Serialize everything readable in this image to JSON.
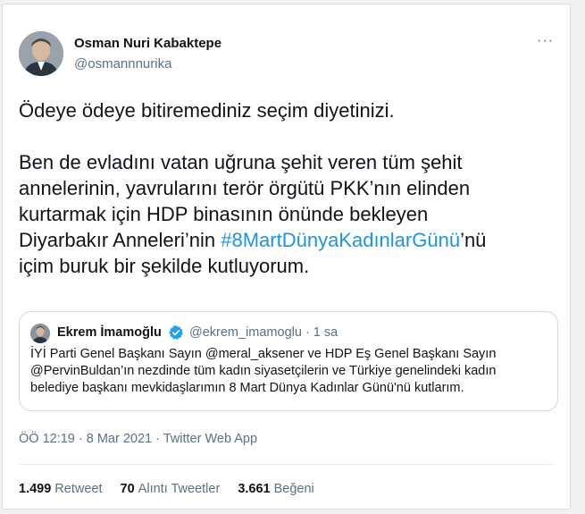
{
  "author": {
    "name": "Osman Nuri Kabaktepe",
    "handle": "@osmannnurika",
    "more": "···"
  },
  "tweet": {
    "line1": "Ödeye ödeye bitiremediniz seçim diyetinizi.",
    "line2": "Ben de evladını vatan uğruna şehit veren tüm şehit",
    "line3": "annelerinin, yavrularını terör örgütü PKK’nın elinden",
    "line4": "kurtarmak için HDP binasının önünde bekleyen",
    "line5_pre": "Diyarbakır Anneleri’nin ",
    "hashtag": "#8MartDünyaKadınlarGünü",
    "line5_post": "’nü",
    "line6": "içim buruk bir şekilde kutluyorum."
  },
  "quote": {
    "name": "Ekrem İmamoğlu",
    "handle_time": "@ekrem_imamoglu · 1 sa",
    "text_line1": "İYİ Parti Genel Başkanı Sayın @meral_aksener ve HDP Eş Genel Başkanı Sayın",
    "text_line2": "@PervinBuldan’ın nezdinde tüm kadın siyasetçilerin ve Türkiye genelindeki kadın",
    "text_line3": "belediye başkanı mevkidaşlarımın 8 Mart Dünya Kadınlar Günü'nü kutlarım."
  },
  "meta": "ÖÖ 12:19 · 8 Mar 2021 · Twitter Web App",
  "stats": {
    "retweets_count": "1.499",
    "retweets_label": "Retweet",
    "quotes_count": "70",
    "quotes_label": "Alıntı Tweetler",
    "likes_count": "3.661",
    "likes_label": "Beğeni"
  },
  "colors": {
    "hashtag": "#1b95e0",
    "verified": "#1da1f2",
    "secondary_text": "#5b7083"
  },
  "icons": {
    "more": "more-icon",
    "verified": "verified-badge-icon"
  }
}
